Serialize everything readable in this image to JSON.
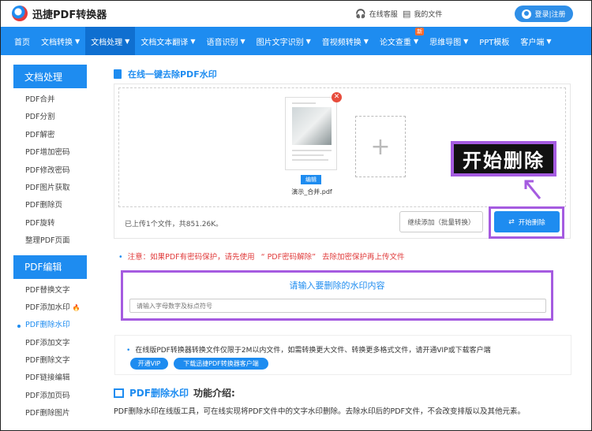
{
  "header": {
    "brand": "迅捷PDF转换器",
    "service_link": "在线客服",
    "files_link": "我的文件",
    "login": "登录|注册"
  },
  "nav": {
    "items": [
      {
        "label": "首页",
        "dropdown": false
      },
      {
        "label": "文档转换",
        "dropdown": true
      },
      {
        "label": "文档处理",
        "dropdown": true,
        "active": true
      },
      {
        "label": "文档文本翻译",
        "dropdown": true
      },
      {
        "label": "语音识别",
        "dropdown": true
      },
      {
        "label": "图片文字识别",
        "dropdown": true
      },
      {
        "label": "音视频转换",
        "dropdown": true
      },
      {
        "label": "论文查重",
        "dropdown": true,
        "badge": "新"
      },
      {
        "label": "思维导图",
        "dropdown": true
      },
      {
        "label": "PPT模板",
        "dropdown": false
      },
      {
        "label": "客户端",
        "dropdown": true
      }
    ]
  },
  "sidebar": {
    "group1_title": "文档处理",
    "group1_items": [
      "PDF合并",
      "PDF分割",
      "PDF解密",
      "PDF增加密码",
      "PDF修改密码",
      "PDF图片获取",
      "PDF删除页",
      "PDF旋转",
      "整理PDF页面"
    ],
    "group2_title": "PDF编辑",
    "group2_items": [
      {
        "label": "PDF替换文字"
      },
      {
        "label": "PDF添加水印",
        "hot": true
      },
      {
        "label": "PDF删除水印",
        "current": true
      },
      {
        "label": "PDF添加文字"
      },
      {
        "label": "PDF删除文字"
      },
      {
        "label": "PDF链接编辑"
      },
      {
        "label": "PDF添加页码"
      },
      {
        "label": "PDF删除图片"
      }
    ]
  },
  "main": {
    "title": "在线一键去除PDF水印",
    "file_tag": "编辑",
    "file_name": "演示_合并.pdf",
    "add_symbol": "+",
    "status": "已上传1个文件，共851.26K。",
    "continue_btn": "继续添加（批量转换）",
    "start_btn": "开始删除",
    "callout": "开始删除",
    "notice_prefix": "注意：如果PDF有密码保护，请先使用",
    "notice_link": "“ PDF密码解除”",
    "notice_suffix": "去除加密保护再上传文件",
    "wm_title": "请输入要删除的水印内容",
    "wm_placeholder": "请输入字母数字及标点符号",
    "vip_text": "在线版PDF转换器转换文件仅限于2M以内文件，如需转换更大文件、转换更多格式文件，请开通VIP或下载客户端",
    "vip_btn": "开通VIP",
    "download_btn": "下载迅捷PDF转换器客户端",
    "intro_title": "PDF删除水印",
    "intro_title_suffix": "功能介绍:",
    "intro_desc": "PDF删除水印在线版工具，可在线实现将PDF文件中的文字水印删除。去除水印后的PDF文件，不会改变排版以及其他元素。"
  },
  "colors": {
    "primary": "#1e8cf0",
    "highlight": "#a55be0",
    "warning": "#e03b3b"
  }
}
